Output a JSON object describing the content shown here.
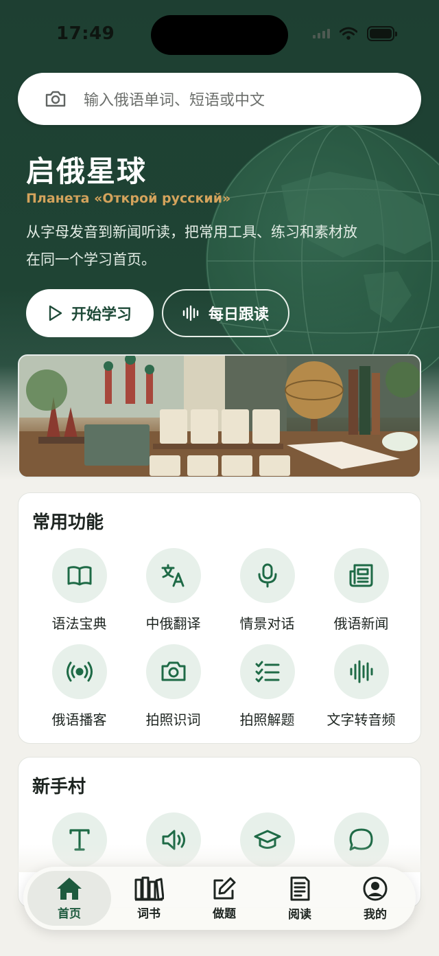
{
  "status": {
    "time": "17:49"
  },
  "search": {
    "placeholder": "输入俄语单词、短语或中文"
  },
  "hero": {
    "title": "启俄星球",
    "subtitle": "Планета «Открой русский»",
    "description": "从字母发音到新闻听读，把常用工具、练习和素材放在同一个学习首页。",
    "start_label": "开始学习",
    "follow_label": "每日跟读"
  },
  "functions": {
    "title": "常用功能",
    "items": [
      {
        "label": "语法宝典",
        "icon": "book-icon"
      },
      {
        "label": "中俄翻译",
        "icon": "translate-icon"
      },
      {
        "label": "情景对话",
        "icon": "microphone-icon"
      },
      {
        "label": "俄语新闻",
        "icon": "newspaper-icon"
      },
      {
        "label": "俄语播客",
        "icon": "podcast-icon"
      },
      {
        "label": "拍照识词",
        "icon": "camera-icon"
      },
      {
        "label": "拍照解题",
        "icon": "checklist-icon"
      },
      {
        "label": "文字转音频",
        "icon": "waveform-icon"
      }
    ]
  },
  "newbie": {
    "title": "新手村",
    "icons": [
      "text-icon",
      "speaker-icon",
      "graduation-cap-icon",
      "chat-bubble-icon"
    ]
  },
  "tabs": [
    {
      "label": "首页",
      "icon": "home-icon",
      "active": true
    },
    {
      "label": "词书",
      "icon": "books-icon"
    },
    {
      "label": "做题",
      "icon": "edit-icon"
    },
    {
      "label": "阅读",
      "icon": "document-icon"
    },
    {
      "label": "我的",
      "icon": "user-icon"
    }
  ],
  "colors": {
    "primary": "#1e5a3e",
    "hero_bg": "#1f4434",
    "accent_gold": "#d4a35c",
    "icon_bg": "#e7f0ea"
  }
}
